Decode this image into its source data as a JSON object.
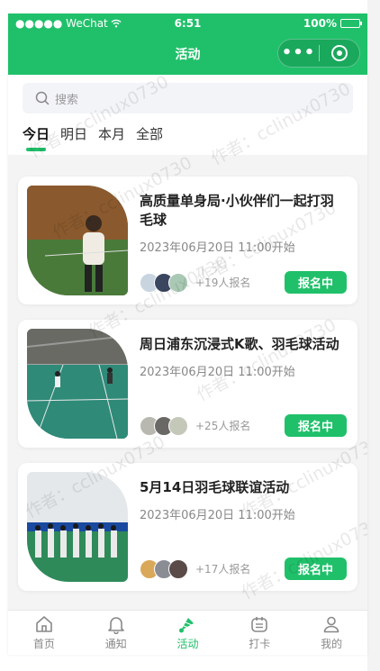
{
  "status_bar": {
    "carrier": "●●●●● WeChat",
    "time": "6:51",
    "battery": "100%"
  },
  "nav": {
    "title": "活动"
  },
  "search": {
    "placeholder": "搜索"
  },
  "tabs": [
    {
      "label": "今日",
      "active": true
    },
    {
      "label": "明日",
      "active": false
    },
    {
      "label": "本月",
      "active": false
    },
    {
      "label": "全部",
      "active": false
    }
  ],
  "events": [
    {
      "title": "高质量单身局·小伙伴们一起打羽毛球",
      "date": "2023年06月20日 11:00开始",
      "count": "+19人报名",
      "status": "报名中"
    },
    {
      "title": "周日浦东沉浸式K歌、羽毛球活动",
      "date": "2023年06月20日 11:00开始",
      "count": "+25人报名",
      "status": "报名中"
    },
    {
      "title": "5月14日羽毛球联谊活动",
      "date": "2023年06月20日 11:00开始",
      "count": "+17人报名",
      "status": "报名中"
    }
  ],
  "tabbar": [
    {
      "label": "首页",
      "icon": "home-icon",
      "active": false
    },
    {
      "label": "通知",
      "icon": "bell-icon",
      "active": false
    },
    {
      "label": "活动",
      "icon": "shuttlecock-icon",
      "active": true
    },
    {
      "label": "打卡",
      "icon": "calendar-icon",
      "active": false
    },
    {
      "label": "我的",
      "icon": "user-icon",
      "active": false
    }
  ],
  "watermark": {
    "text": "作者：cclinux0730"
  },
  "colors": {
    "accent": "#20c06a"
  }
}
